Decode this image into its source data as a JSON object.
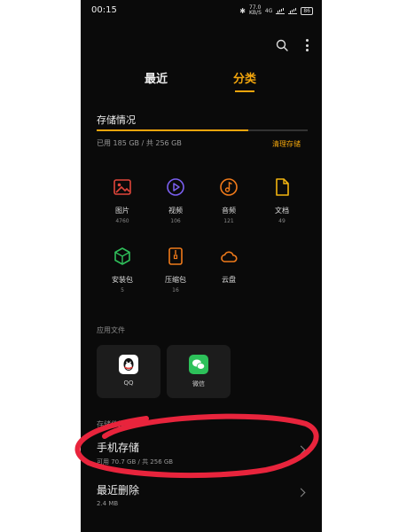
{
  "status": {
    "time": "00:15",
    "net_speed": "77.0",
    "net_unit": "KB/S",
    "network": "4G",
    "battery": "86"
  },
  "tabs": {
    "recent": "最近",
    "category": "分类"
  },
  "storage": {
    "title": "存储情况",
    "used_text": "已用 185 GB / 共 256 GB",
    "clean_label": "清理存储",
    "used_fraction": 0.72
  },
  "categories": [
    {
      "label": "图片",
      "count": "4760",
      "icon": "image-icon",
      "color": "#e0453a"
    },
    {
      "label": "视频",
      "count": "106",
      "icon": "video-icon",
      "color": "#7a5ff0"
    },
    {
      "label": "音频",
      "count": "121",
      "icon": "audio-icon",
      "color": "#f07a1a"
    },
    {
      "label": "文档",
      "count": "49",
      "icon": "document-icon",
      "color": "#f2b410"
    },
    {
      "label": "安装包",
      "count": "5",
      "icon": "package-icon",
      "color": "#2fbf5a"
    },
    {
      "label": "压缩包",
      "count": "16",
      "icon": "archive-icon",
      "color": "#f07a1a"
    },
    {
      "label": "云盘",
      "count": "",
      "icon": "cloud-icon",
      "color": "#f07a1a"
    }
  ],
  "apps_section": {
    "title": "应用文件",
    "items": [
      {
        "label": "QQ",
        "icon": "qq-icon"
      },
      {
        "label": "微信",
        "icon": "wechat-icon"
      }
    ]
  },
  "locations": {
    "title": "存储位置",
    "phone_storage": {
      "title": "手机存储",
      "sub": "可用 70.7 GB / 共 256 GB"
    },
    "recently_deleted": {
      "title": "最近删除",
      "sub": "2.4 MB"
    }
  },
  "colors": {
    "accent": "#f2a50c",
    "annotation": "#e8243c",
    "background": "#0a0a0a"
  }
}
